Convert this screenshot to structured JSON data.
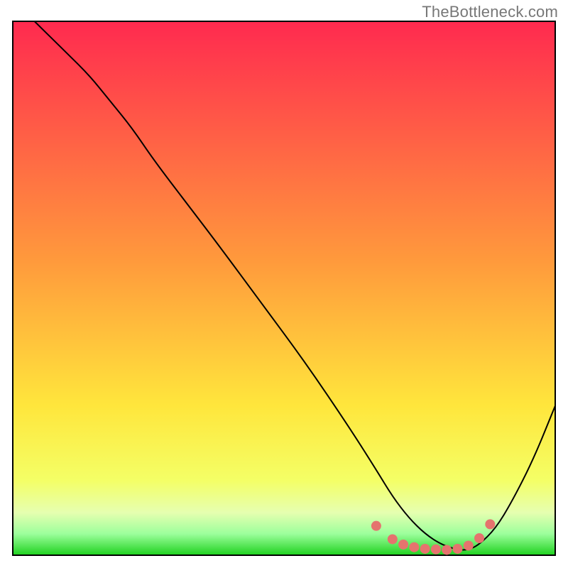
{
  "watermark": {
    "text": "TheBottleneck.com"
  },
  "chart_data": {
    "type": "line",
    "title": "",
    "xlabel": "",
    "ylabel": "",
    "xlim": [
      0,
      100
    ],
    "ylim": [
      0,
      100
    ],
    "grid": false,
    "legend": false,
    "background_gradient": {
      "stops": [
        {
          "offset": 0.0,
          "color": "#ff2a4f"
        },
        {
          "offset": 0.45,
          "color": "#ff9a3c"
        },
        {
          "offset": 0.72,
          "color": "#ffe63c"
        },
        {
          "offset": 0.86,
          "color": "#f4ff66"
        },
        {
          "offset": 0.92,
          "color": "#e6ffb0"
        },
        {
          "offset": 0.96,
          "color": "#9cff9c"
        },
        {
          "offset": 1.0,
          "color": "#1fd11f"
        }
      ]
    },
    "series": [
      {
        "name": "bottleneck-curve",
        "x": [
          4,
          7,
          10,
          14,
          18,
          22,
          26,
          32,
          38,
          46,
          54,
          62,
          67,
          70,
          73,
          76,
          79,
          82,
          84,
          86,
          89,
          92,
          96,
          100
        ],
        "y": [
          100,
          97,
          94,
          90,
          85,
          80,
          74,
          66,
          58,
          47,
          36,
          24,
          16,
          11,
          7,
          4,
          2,
          1,
          1,
          2,
          5,
          10,
          18,
          28
        ],
        "color": "#000000",
        "stroke_width": 2
      }
    ],
    "markers": [
      {
        "name": "optimal-zone-dots",
        "color": "#e5736e",
        "radius": 7,
        "points": [
          {
            "x": 67,
            "y": 5.5
          },
          {
            "x": 70,
            "y": 3.0
          },
          {
            "x": 72,
            "y": 2.0
          },
          {
            "x": 74,
            "y": 1.5
          },
          {
            "x": 76,
            "y": 1.2
          },
          {
            "x": 78,
            "y": 1.1
          },
          {
            "x": 80,
            "y": 1.0
          },
          {
            "x": 82,
            "y": 1.2
          },
          {
            "x": 84,
            "y": 1.8
          },
          {
            "x": 86,
            "y": 3.2
          },
          {
            "x": 88,
            "y": 5.8
          }
        ]
      }
    ]
  }
}
